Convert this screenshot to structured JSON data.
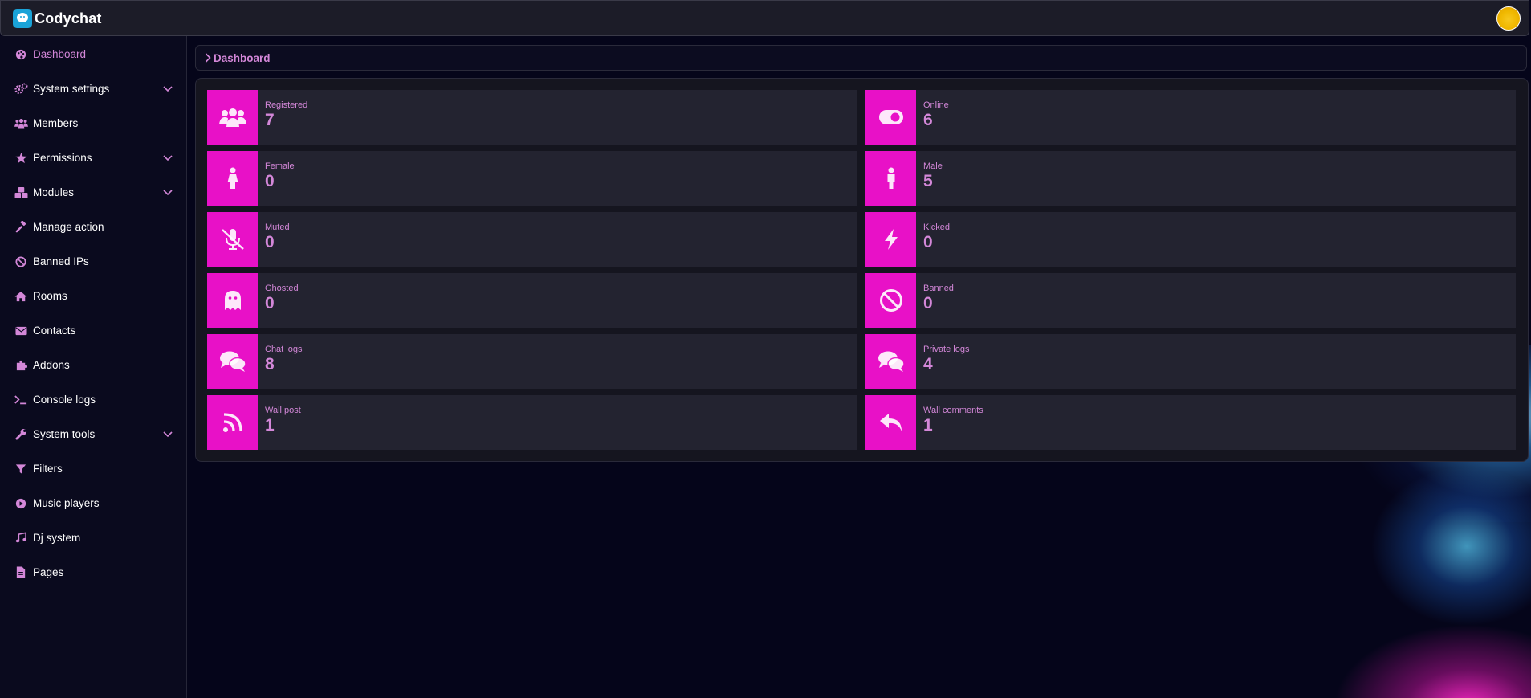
{
  "app": {
    "name": "Codychat"
  },
  "sidebar": {
    "items": [
      {
        "label": "Dashboard",
        "icon": "palette-icon",
        "active": true,
        "expandable": false
      },
      {
        "label": "System settings",
        "icon": "cogs-icon",
        "active": false,
        "expandable": true
      },
      {
        "label": "Members",
        "icon": "users-icon",
        "active": false,
        "expandable": false
      },
      {
        "label": "Permissions",
        "icon": "star-icon",
        "active": false,
        "expandable": true
      },
      {
        "label": "Modules",
        "icon": "cubes-icon",
        "active": false,
        "expandable": true
      },
      {
        "label": "Manage action",
        "icon": "gavel-icon",
        "active": false,
        "expandable": false
      },
      {
        "label": "Banned IPs",
        "icon": "ban-icon",
        "active": false,
        "expandable": false
      },
      {
        "label": "Rooms",
        "icon": "home-icon",
        "active": false,
        "expandable": false
      },
      {
        "label": "Contacts",
        "icon": "envelope-icon",
        "active": false,
        "expandable": false
      },
      {
        "label": "Addons",
        "icon": "puzzle-icon",
        "active": false,
        "expandable": false
      },
      {
        "label": "Console logs",
        "icon": "terminal-icon",
        "active": false,
        "expandable": false
      },
      {
        "label": "System tools",
        "icon": "wrench-icon",
        "active": false,
        "expandable": true
      },
      {
        "label": "Filters",
        "icon": "filter-icon",
        "active": false,
        "expandable": false
      },
      {
        "label": "Music players",
        "icon": "play-circle-icon",
        "active": false,
        "expandable": false
      },
      {
        "label": "Dj system",
        "icon": "music-icon",
        "active": false,
        "expandable": false
      },
      {
        "label": "Pages",
        "icon": "file-icon",
        "active": false,
        "expandable": false
      }
    ]
  },
  "breadcrumb": {
    "label": "Dashboard"
  },
  "stats": [
    {
      "title": "Registered",
      "value": "7",
      "icon": "users-icon"
    },
    {
      "title": "Online",
      "value": "6",
      "icon": "toggle-icon"
    },
    {
      "title": "Female",
      "value": "0",
      "icon": "female-icon"
    },
    {
      "title": "Male",
      "value": "5",
      "icon": "male-icon"
    },
    {
      "title": "Muted",
      "value": "0",
      "icon": "microphone-slash-icon"
    },
    {
      "title": "Kicked",
      "value": "0",
      "icon": "bolt-icon"
    },
    {
      "title": "Ghosted",
      "value": "0",
      "icon": "ghost-icon"
    },
    {
      "title": "Banned",
      "value": "0",
      "icon": "ban-icon"
    },
    {
      "title": "Chat logs",
      "value": "8",
      "icon": "comments-icon"
    },
    {
      "title": "Private logs",
      "value": "4",
      "icon": "comments-icon"
    },
    {
      "title": "Wall post",
      "value": "1",
      "icon": "rss-icon"
    },
    {
      "title": "Wall comments",
      "value": "1",
      "icon": "reply-icon"
    }
  ],
  "colors": {
    "accent": "#e811c7",
    "accent_text": "#d387d8",
    "background": "#05051a",
    "card": "#232330"
  }
}
